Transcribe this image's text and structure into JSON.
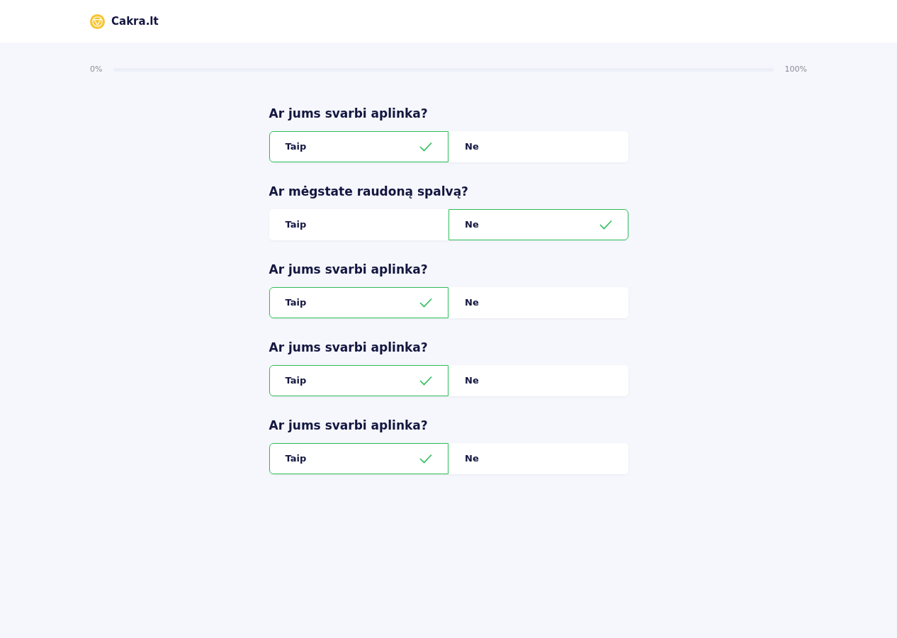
{
  "header": {
    "brand": "Cakra.lt"
  },
  "progress": {
    "start_label": "0%",
    "end_label": "100%",
    "level": 0
  },
  "questions": [
    {
      "title": "Ar jums svarbi aplinka?",
      "options": [
        {
          "label": "Taip",
          "selected": true
        },
        {
          "label": "Ne",
          "selected": false
        }
      ]
    },
    {
      "title": "Ar mėgstate raudoną spalvą?",
      "options": [
        {
          "label": "Taip",
          "selected": false
        },
        {
          "label": "Ne",
          "selected": true
        }
      ]
    },
    {
      "title": "Ar jums svarbi aplinka?",
      "options": [
        {
          "label": "Taip",
          "selected": true
        },
        {
          "label": "Ne",
          "selected": false
        }
      ]
    },
    {
      "title": "Ar jums svarbi aplinka?",
      "options": [
        {
          "label": "Taip",
          "selected": true
        },
        {
          "label": "Ne",
          "selected": false
        }
      ]
    },
    {
      "title": "Ar jums svarbi aplinka?",
      "options": [
        {
          "label": "Taip",
          "selected": true
        },
        {
          "label": "Ne",
          "selected": false
        }
      ]
    }
  ]
}
